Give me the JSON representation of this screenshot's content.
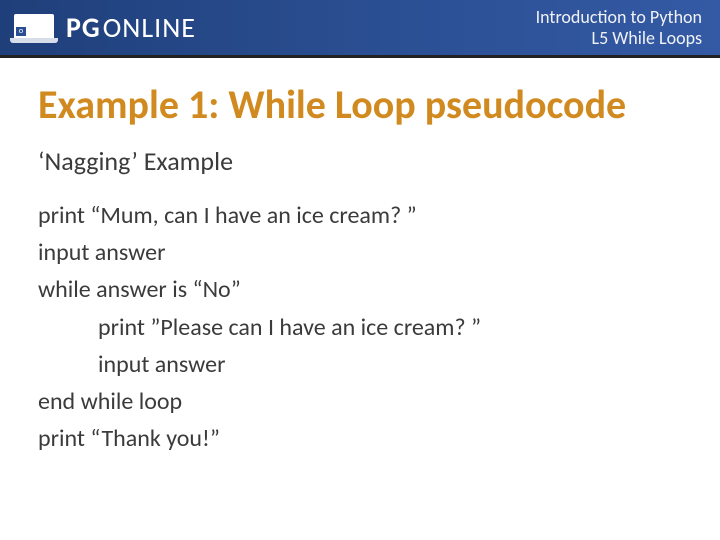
{
  "header": {
    "brand_pg": "PG",
    "brand_online": "ONLINE",
    "laptop_key": "o",
    "course_line1": "Introduction to Python",
    "course_line2": "L5 While Loops"
  },
  "title": "Example 1: While Loop pseudocode",
  "subtitle": "‘Nagging’ Example",
  "code": {
    "l1": "print “Mum, can I have an ice cream? ”",
    "l2": "input answer",
    "l3": "while answer is “No”",
    "l4": "print ”Please can I have an ice cream? ”",
    "l5": "input answer",
    "l6": "end while loop",
    "l7": "print “Thank you!”"
  }
}
